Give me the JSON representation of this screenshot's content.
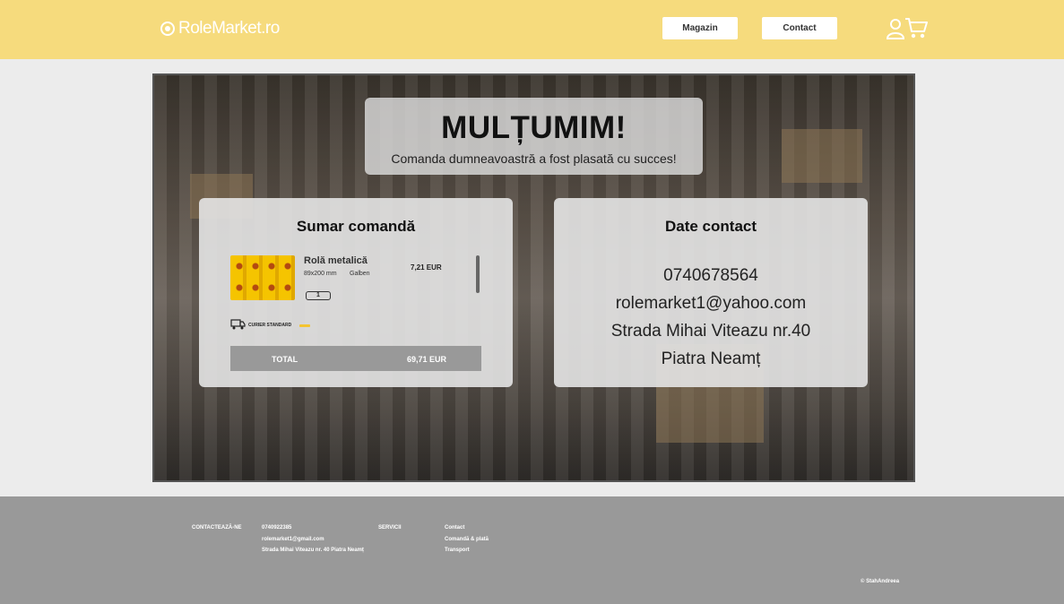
{
  "header": {
    "logo_text": "RoleMarket.ro",
    "nav": {
      "magazin_label": "Magazin",
      "contact_label": "Contact"
    },
    "icons": [
      "user-icon",
      "cart-icon"
    ]
  },
  "thanks": {
    "title": "MULȚUMIM!",
    "subtitle": "Comanda dumneavoastră a fost plasată cu succes!"
  },
  "summary": {
    "title": "Sumar comandă",
    "product": {
      "name": "Rolă metalică",
      "size": "89x200 mm",
      "color": "Galben",
      "price": "7,21 EUR",
      "quantity": "1"
    },
    "shipping_label": "CURIER STANDARD",
    "total_label": "TOTAL",
    "total_value": "69,71 EUR"
  },
  "contact": {
    "title": "Date contact",
    "phone": "0740678564",
    "email": "rolemarket1@yahoo.com",
    "street": "Strada Mihai Viteazu nr.40",
    "city": "Piatra Neamț"
  },
  "footer": {
    "contact_heading": "CONTACTEAZĂ-NE",
    "phone": "0740922385",
    "email": "rolemarket1@gmail.com",
    "address": "Strada Mihai Viteazu nr. 40 Piatra Neamț",
    "services_heading": "SERVICII",
    "links": [
      "Contact",
      "Comandă & plată",
      "Transport"
    ],
    "copyright": "© StahAndreea"
  },
  "colors": {
    "header_bg": "#f6db7d",
    "footer_bg": "#999999",
    "accent": "#f4c430"
  }
}
